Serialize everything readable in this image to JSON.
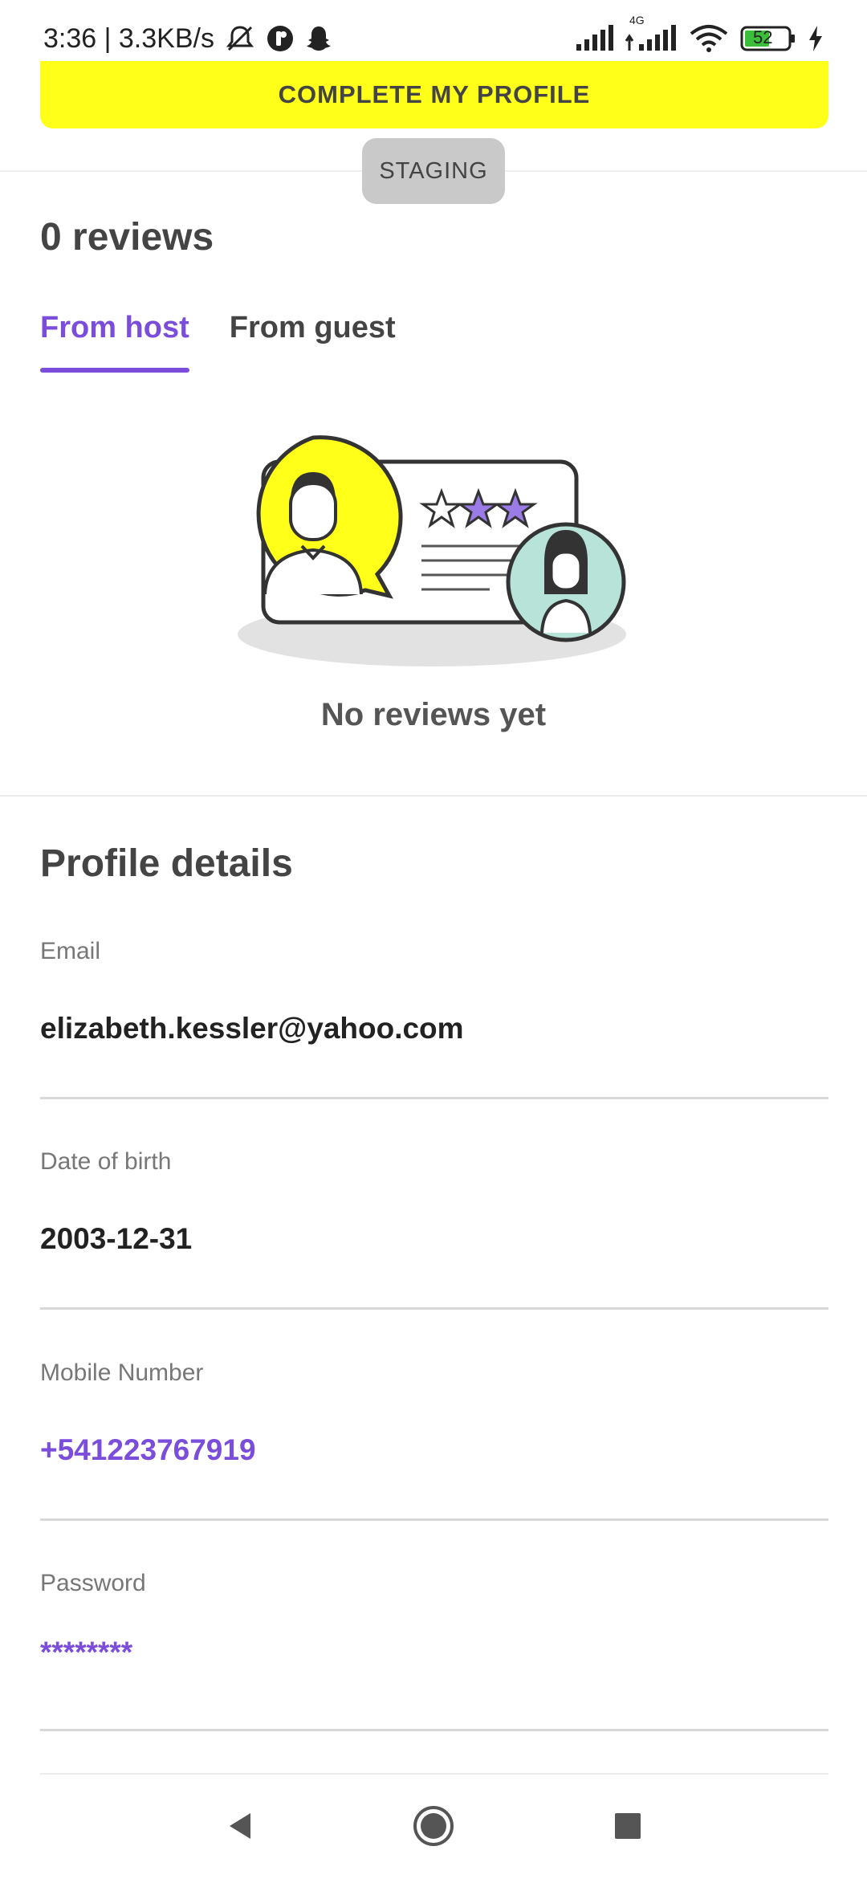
{
  "status_bar": {
    "time_speed": "3:36 | 3.3KB/s",
    "network_label": "4G",
    "battery": "52"
  },
  "banner": {
    "label": "COMPLETE MY PROFILE"
  },
  "staging": {
    "label": "STAGING"
  },
  "reviews": {
    "title": "0 reviews",
    "tabs": [
      {
        "label": "From host",
        "active": true
      },
      {
        "label": "From guest",
        "active": false
      }
    ],
    "empty_text": "No reviews yet"
  },
  "profile": {
    "title": "Profile details",
    "fields": [
      {
        "label": "Email",
        "value": "elizabeth.kessler@yahoo.com"
      },
      {
        "label": "Date of birth",
        "value": "2003-12-31"
      },
      {
        "label": "Mobile Number",
        "value": "+541223767919"
      },
      {
        "label": "Password",
        "value": "********"
      }
    ]
  },
  "colors": {
    "accent": "#7b4ddb",
    "banner": "#ffff1a",
    "staging_bg": "#c9c9c9"
  },
  "icons": {
    "status": [
      "mute-icon",
      "app-icon",
      "snapchat-icon",
      "signal-icon",
      "wifi-icon",
      "battery-icon",
      "charging-icon"
    ],
    "nav": [
      "back-icon",
      "home-icon",
      "recents-icon"
    ]
  }
}
